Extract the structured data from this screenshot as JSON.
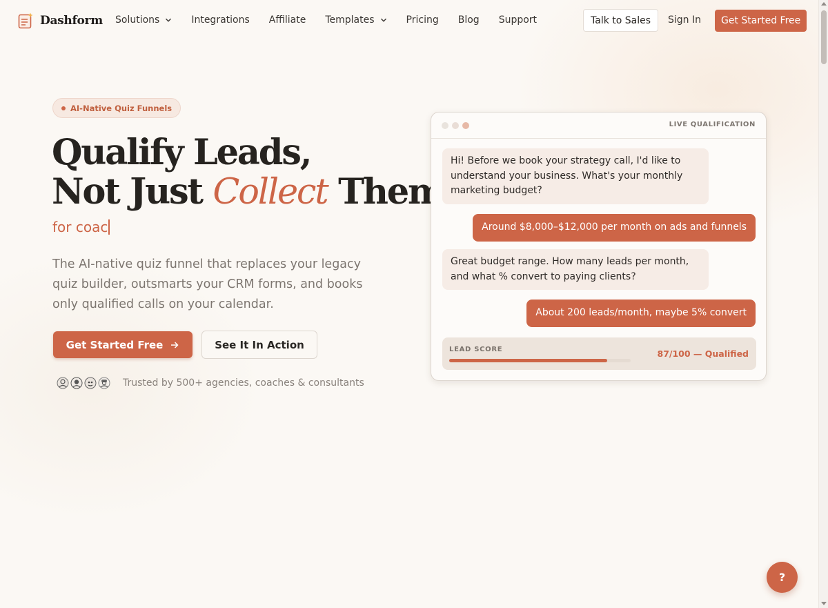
{
  "brand": {
    "name": "Dashform",
    "accent": "#cd6547"
  },
  "nav": {
    "items": [
      {
        "label": "Solutions",
        "dropdown": true
      },
      {
        "label": "Integrations",
        "dropdown": false
      },
      {
        "label": "Affiliate",
        "dropdown": false
      },
      {
        "label": "Templates",
        "dropdown": true
      },
      {
        "label": "Pricing",
        "dropdown": false
      },
      {
        "label": "Blog",
        "dropdown": false
      },
      {
        "label": "Support",
        "dropdown": false
      }
    ],
    "talk_to_sales": "Talk to Sales",
    "sign_in": "Sign In",
    "get_started": "Get Started Free"
  },
  "hero": {
    "badge": "AI-Native Quiz Funnels",
    "headline_line1": "Qualify Leads,",
    "headline_line2_start": "Not Just ",
    "headline_accent": "Collect",
    "headline_line2_end": " Them",
    "typed_text": "for coac",
    "subtitle": "The AI-native quiz funnel that replaces your legacy quiz builder, outsmarts your CRM forms, and books only qualified calls on your calendar.",
    "cta_primary": "Get Started Free",
    "cta_secondary": "See It In Action",
    "trust_text": "Trusted by 500+ agencies, coaches & consultants",
    "avatar_icons": [
      "person-avatar-icon",
      "person-avatar-icon",
      "person-avatar-icon",
      "person-avatar-icon"
    ]
  },
  "chat_card": {
    "label": "LIVE QUALIFICATION",
    "window_dots": [
      "#e9e3dd",
      "#e9ddd6",
      "#e7b9a7"
    ],
    "messages": [
      {
        "role": "bot",
        "text": "Hi! Before we book your strategy call, I'd like to understand your business. What's your monthly marketing budget?"
      },
      {
        "role": "user",
        "text": "Around $8,000–$12,000 per month on ads and funnels"
      },
      {
        "role": "bot",
        "text": "Great budget range. How many leads per month, and what % convert to paying clients?"
      },
      {
        "role": "user",
        "text": "About 200 leads/month, maybe 5% convert"
      }
    ],
    "lead_score": {
      "label": "LEAD SCORE",
      "value_text": "87/100 — Qualified",
      "score": 87,
      "max": 100
    }
  },
  "help_button": "?"
}
